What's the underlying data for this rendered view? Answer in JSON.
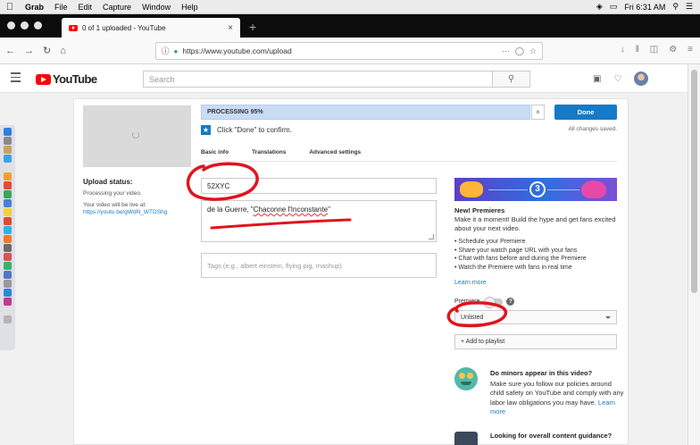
{
  "menubar": {
    "app": "Grab",
    "items": [
      "File",
      "Edit",
      "Capture",
      "Window",
      "Help"
    ],
    "clock": "Fri 6:31 AM"
  },
  "browser": {
    "tab_title": "0 of 1 uploaded - YouTube",
    "url": "https://www.youtube.com/upload"
  },
  "youtube": {
    "logo": "YouTube",
    "search_placeholder": "Search"
  },
  "upload": {
    "progress_label": "PROCESSING 95%",
    "progress_fraction": 0.95,
    "dismiss_label": "×",
    "done_label": "Done",
    "confirm_text": "Click \"Done\" to confirm.",
    "saved_text": "All changes saved.",
    "tabs": [
      "Basic info",
      "Translations",
      "Advanced settings"
    ],
    "status_heading": "Upload status:",
    "status_text": "Processing your video.",
    "live_text": "Your video will be live at:",
    "live_url": "https://youtu.be/gWdN_WTDShg",
    "title_value": "52XYC",
    "desc_value_plain": "de la Guerre, \"",
    "desc_value_under": "Chaconne l'Inconstante",
    "desc_value_end": "\"",
    "tags_placeholder": "Tags (e.g., albert einstein, flying pig, mashup)"
  },
  "premieres": {
    "promo_number": "3",
    "title": "New! Premieres",
    "desc": "Make it a moment! Build the hype and get fans excited about your next video.",
    "bullets": [
      "Schedule your Premiere",
      "Share your watch page URL with your fans",
      "Chat with fans before and during the Premiere",
      "Watch the Premiere with fans in real time"
    ],
    "learn_more": "Learn more",
    "toggle_label": "Premiere",
    "help": "?"
  },
  "visibility": {
    "selected": "Unlisted",
    "playlist_label": "+ Add to playlist"
  },
  "minors": {
    "heading": "Do minors appear in this video?",
    "text": "Make sure you follow our policies around child safety on YouTube and comply with any labor law obligations you may have.",
    "link": "Learn more"
  },
  "guidance": {
    "heading": "Looking for overall content guidance?"
  },
  "colors": {
    "accent": "#167ac6",
    "youtube_red": "#ff0000",
    "annotation_red": "#e0141e"
  }
}
